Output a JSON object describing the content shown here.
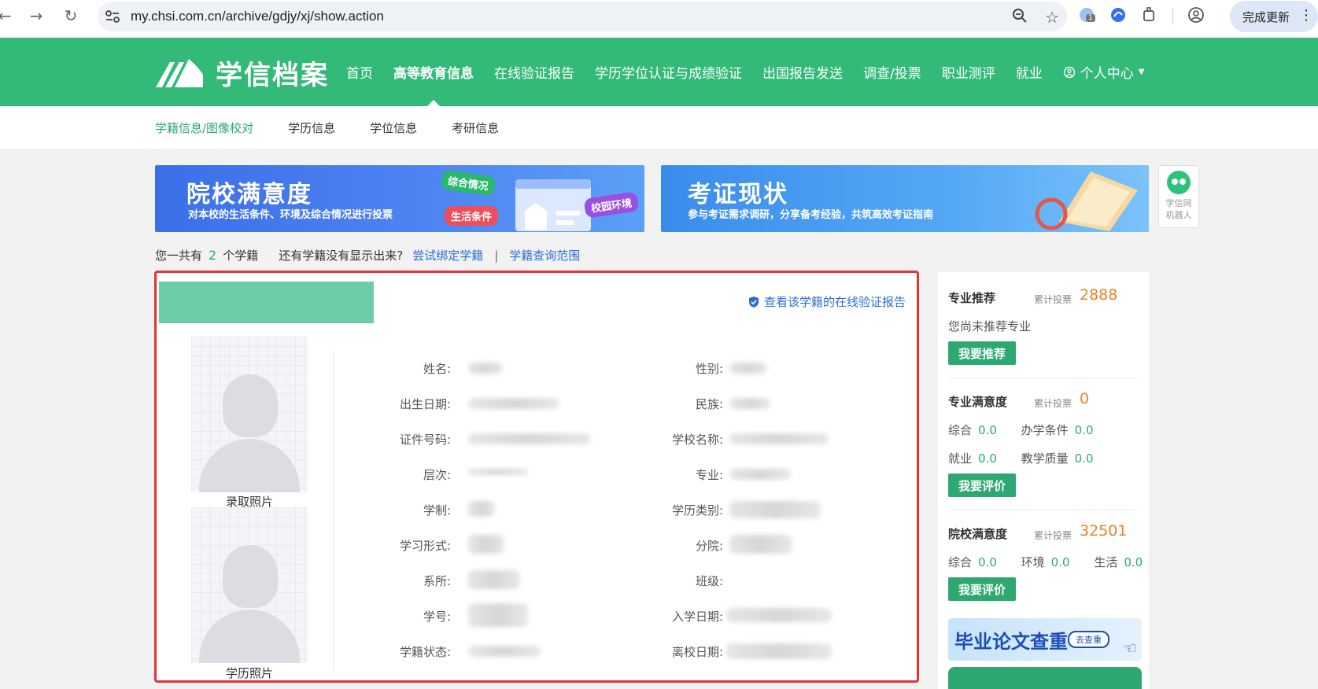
{
  "browser": {
    "url": "my.chsi.com.cn/archive/gdjy/xj/show.action",
    "update_label": "完成更新",
    "ext_badge": "1"
  },
  "header": {
    "logo_text": "学信档案",
    "nav": [
      "首页",
      "高等教育信息",
      "在线验证报告",
      "学历学位认证与成绩验证",
      "出国报告发送",
      "调查/投票",
      "职业测评",
      "就业"
    ],
    "personal": "个人中心"
  },
  "subnav": {
    "tabs": [
      "学籍信息/图像校对",
      "学历信息",
      "学位信息",
      "考研信息"
    ]
  },
  "banner1": {
    "title": "院校满意度",
    "subtitle": "对本校的生活条件、环境及综合情况进行投票",
    "tags": [
      "综合情况",
      "生活条件",
      "校园环境"
    ]
  },
  "banner2": {
    "title": "考证现状",
    "subtitle": "参与考证需求调研，分享备考经验，共筑高效考证指南"
  },
  "robot": {
    "line1": "学信网",
    "line2": "机器人"
  },
  "summary": {
    "prefix": "您一共有",
    "count": "2",
    "suffix": "个学籍",
    "question": "还有学籍没有显示出来?",
    "bind_link": "尝试绑定学籍",
    "sep": "|",
    "scope_link": "学籍查询范围"
  },
  "card": {
    "verify_link": "查看该学籍的在线验证报告",
    "photo1_label": "录取照片",
    "photo2_label": "学历照片",
    "left_fields": [
      "姓名:",
      "出生日期:",
      "证件号码:",
      "层次:",
      "学制:",
      "学习形式:",
      "系所:",
      "学号:",
      "学籍状态:"
    ],
    "right_fields": [
      "性别:",
      "民族:",
      "学校名称:",
      "专业:",
      "学历类别:",
      "分院:",
      "班级:",
      "入学日期:",
      "离校日期:"
    ]
  },
  "side": {
    "major_rec": {
      "title": "专业推荐",
      "votes_label": "累计投票",
      "votes": "2888",
      "text": "您尚未推荐专业",
      "button": "我要推荐"
    },
    "major_sat": {
      "title": "专业满意度",
      "votes_label": "累计投票",
      "votes": "0",
      "row1": [
        {
          "label": "综合",
          "value": "0.0"
        },
        {
          "label": "办学条件",
          "value": "0.0"
        }
      ],
      "row2": [
        {
          "label": "就业",
          "value": "0.0"
        },
        {
          "label": "教学质量",
          "value": "0.0"
        }
      ],
      "button": "我要评价"
    },
    "school_sat": {
      "title": "院校满意度",
      "votes_label": "累计投票",
      "votes": "32501",
      "row": [
        {
          "label": "综合",
          "value": "0.0"
        },
        {
          "label": "环境",
          "value": "0.0"
        },
        {
          "label": "生活",
          "value": "0.0"
        }
      ],
      "button": "我要评价"
    },
    "ad": {
      "text": "毕业论文查重",
      "pill": "去查重"
    }
  }
}
